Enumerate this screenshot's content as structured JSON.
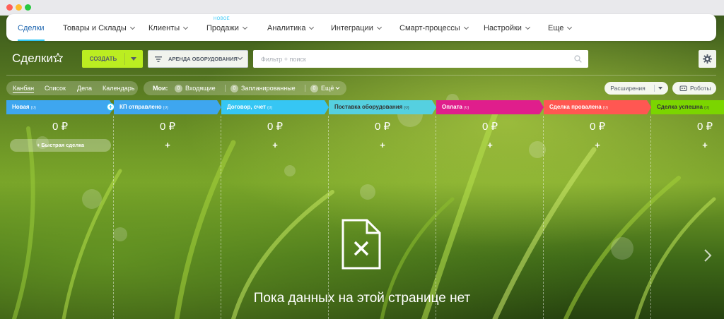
{
  "nav": {
    "items": [
      {
        "label": "Сделки",
        "active": true
      },
      {
        "label": "Товары и Склады",
        "chevron": true
      },
      {
        "label": "Клиенты",
        "chevron": true
      },
      {
        "label": "Продажи",
        "chevron": true
      },
      {
        "label": "Аналитика",
        "chevron": true
      },
      {
        "label": "Интеграции",
        "chevron": true
      },
      {
        "label": "Смарт-процессы",
        "chevron": true
      },
      {
        "label": "Настройки",
        "chevron": true
      },
      {
        "label": "Еще",
        "chevron": true
      }
    ],
    "badge": "НОВОЕ"
  },
  "toolbar": {
    "title": "Сделки",
    "create_label": "СОЗДАТЬ",
    "category_label": "АРЕНДА ОБОРУДОВАНИЯ",
    "filter_placeholder": "Фильтр + поиск"
  },
  "views": {
    "items": [
      "Канбан",
      "Список",
      "Дела",
      "Календарь"
    ],
    "active": "Канбан"
  },
  "counters": {
    "label": "Мои:",
    "items": [
      {
        "count": "0",
        "label": "Входящие"
      },
      {
        "count": "0",
        "label": "Запланированные"
      },
      {
        "count": "0",
        "label": "Ещё"
      }
    ]
  },
  "right_buttons": {
    "extensions": "Расширения",
    "robots": "Роботы"
  },
  "columns": [
    {
      "title": "Новая",
      "count": "(0)",
      "sum": "0 ₽",
      "color": "#3ea6ef",
      "text_color": "#fff"
    },
    {
      "title": "КП отправлено",
      "count": "(0)",
      "sum": "0 ₽",
      "color": "#3ea6ef",
      "text_color": "#fff"
    },
    {
      "title": "Договор, счет",
      "count": "(0)",
      "sum": "0 ₽",
      "color": "#36c6f4",
      "text_color": "#fff"
    },
    {
      "title": "Поставка оборудования",
      "count": "(0)",
      "sum": "0 ₽",
      "color": "#55d0e0",
      "text_color": "#333"
    },
    {
      "title": "Оплата",
      "count": "(0)",
      "sum": "0 ₽",
      "color": "#e01e8c",
      "text_color": "#fff"
    },
    {
      "title": "Сделка провалена",
      "count": "(0)",
      "sum": "0 ₽",
      "color": "#ff5752",
      "text_color": "#fff"
    },
    {
      "title": "Сделка успешна",
      "count": "(0)",
      "sum": "0 ₽",
      "color": "#7bd500",
      "text_color": "#333"
    }
  ],
  "quick_add_label": "+ Быстрая сделка",
  "plus": "+",
  "empty_text": "Пока данных на этой странице нет",
  "icons": {
    "star": "star-icon",
    "filter": "filter-lines-icon",
    "search": "search-icon",
    "settings": "gear-icon",
    "robots": "robot-icon",
    "empty": "file-x-icon",
    "next": "chevron-right-icon"
  }
}
